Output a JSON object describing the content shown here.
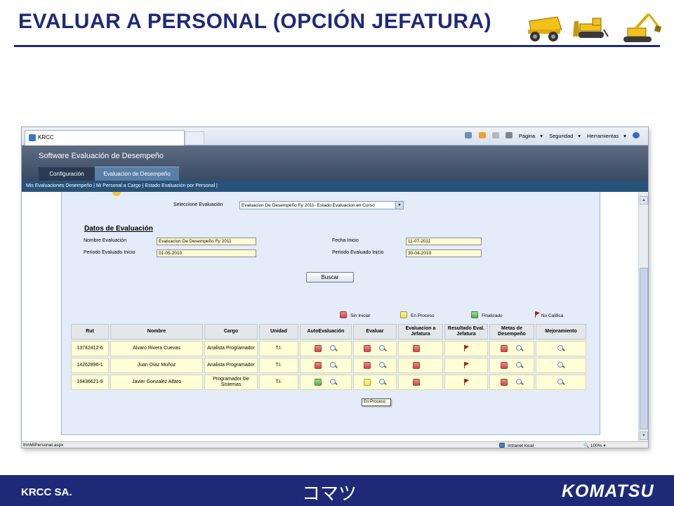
{
  "slide": {
    "title": "EVALUAR A PERSONAL (OPCIÓN JEFATURA)",
    "footer_left": "KRCC SA.",
    "footer_center": "コマツ",
    "footer_right": "KOMATSU",
    "accent_color": "#1e2a78"
  },
  "browser": {
    "tab_title": "KRCC",
    "commands": [
      "Página",
      "Seguridad",
      "Herramientas"
    ],
    "status_url": "frmMiPersonal.aspx",
    "status_zone": "Intranet local",
    "status_zoom": "100%"
  },
  "app": {
    "title": "Software Evaluación de Desempeño",
    "tabs": [
      "Configuración",
      "Evaluacion de Desempeño"
    ],
    "nav": "Mis Evaluaciones Desempeño | Mi Personal a Cargo | Estado Evaluación por Personal |"
  },
  "form": {
    "select_label": "Seleccione Evaluación",
    "select_value": "Evaluacion De Desempeño Fy 2011- Estado:Evaluacion en Curso",
    "section_title": "Datos de Evaluación",
    "nombre_label": "Nombre Evaluación",
    "nombre_value": "Evaluacion De Desempeño Fy 2011",
    "fecha_label": "Fecha Inicio",
    "fecha_value": "11-07-2011",
    "periodo_ini_label": "Periodo Evaluado Inicio",
    "periodo_ini_value": "01-05-2010",
    "periodo_fin_label": "Periodo Evaluado Inicio",
    "periodo_fin_value": "30-04-2010",
    "search_button": "Buscar"
  },
  "legend": {
    "sin_iniciar": "Sin Iniciar",
    "en_proceso": "En Proceso",
    "finalizado": "Finalizado",
    "no_califica": "No Califica"
  },
  "status_colors": {
    "red": "#d44444",
    "yellow": "#f3df3e",
    "green": "#51ad3e"
  },
  "table": {
    "headers": [
      "Rut",
      "Nombre",
      "Cargo",
      "Unidad",
      "AutoEvaluación",
      "Evaluar",
      "Evaluacion a Jefatura",
      "Resultado Eval. Jefatura",
      "Metas de Desempeño",
      "Mejoramiento"
    ],
    "rows": [
      {
        "rut": "13742412-6",
        "nombre": "Alvaro Rivera Cuevas",
        "cargo": "Analista Programador",
        "unidad": "T.I.",
        "auto": "red",
        "evaluar": "red",
        "eval_jefatura": "red",
        "resultado": "no-califica",
        "metas": "red"
      },
      {
        "rut": "14262896-1",
        "nombre": "Juan Díaz Muñoz",
        "cargo": "Analista Programador",
        "unidad": "T.I.",
        "auto": "red",
        "evaluar": "red",
        "eval_jefatura": "red",
        "resultado": "no-califica",
        "metas": "red"
      },
      {
        "rut": "16436621-9",
        "nombre": "Javier Gonzalez Alfaro",
        "cargo": "Programador De Sistemas",
        "unidad": "T.I.",
        "auto": "green",
        "evaluar": "yellow",
        "eval_jefatura": "red",
        "resultado": "no-califica",
        "metas": "red"
      }
    ]
  },
  "tooltip": "En Proceso"
}
